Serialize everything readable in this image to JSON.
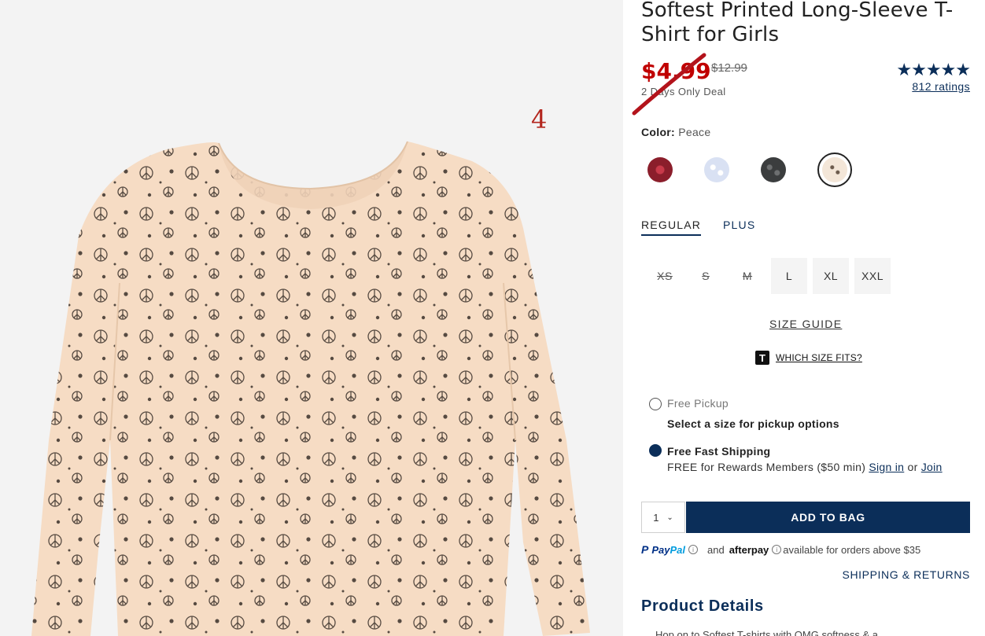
{
  "product": {
    "title": "Softest Printed Long-Sleeve T-Shirt for Girls",
    "sale_price": "$4.99",
    "original_price": "$12.99",
    "deal_note": "2 Days Only Deal",
    "stars_text": "★★★★★",
    "ratings_link": "812 ratings",
    "image_annotation": "4"
  },
  "color": {
    "label": "Color:",
    "selected": "Peace",
    "swatches": [
      {
        "name": "Red",
        "color": "#8b1e2b"
      },
      {
        "name": "Light Blue Floral",
        "color": "#d9e1f3"
      },
      {
        "name": "Charcoal Floral",
        "color": "#3b3d3e"
      },
      {
        "name": "Peace",
        "color": "#f3e6d8",
        "selected": true
      }
    ]
  },
  "fit_tabs": [
    {
      "label": "REGULAR",
      "active": true
    },
    {
      "label": "PLUS",
      "active": false
    }
  ],
  "sizes": [
    {
      "label": "XS",
      "available": false
    },
    {
      "label": "S",
      "available": false
    },
    {
      "label": "M",
      "available": false
    },
    {
      "label": "L",
      "available": true
    },
    {
      "label": "XL",
      "available": true
    },
    {
      "label": "XXL",
      "available": true
    }
  ],
  "size_guide": "SIZE GUIDE",
  "which_size": {
    "icon_letter": "T",
    "label": "WHICH SIZE FITS?"
  },
  "fulfillment": {
    "pickup": {
      "title": "Free Pickup",
      "sub": "Select a size for pickup options",
      "selected": false
    },
    "shipping": {
      "title": "Free Fast Shipping",
      "sub_prefix": "FREE for Rewards Members ($50 min)",
      "sign_in": "Sign in",
      "or": "or",
      "join": "Join",
      "selected": true
    }
  },
  "cart": {
    "quantity": "1",
    "chevron": "⌄",
    "add_label": "ADD TO BAG"
  },
  "payment": {
    "paypal_p": "P",
    "paypal_pay": "Pay",
    "paypal_pal": "Pal",
    "info_glyph": "i",
    "and": "and",
    "afterpay": "afterpay",
    "afterpay_note": "available for orders above $35"
  },
  "shipping_returns": "SHIPPING & RETURNS",
  "details": {
    "heading": "Product Details",
    "first_line": "Hop on to Softest T-shirts with OMG softness & a..."
  },
  "colors": {
    "brand_navy": "#0b2e59",
    "sale_red": "#c00000",
    "shirt": "#f6dcc4"
  }
}
